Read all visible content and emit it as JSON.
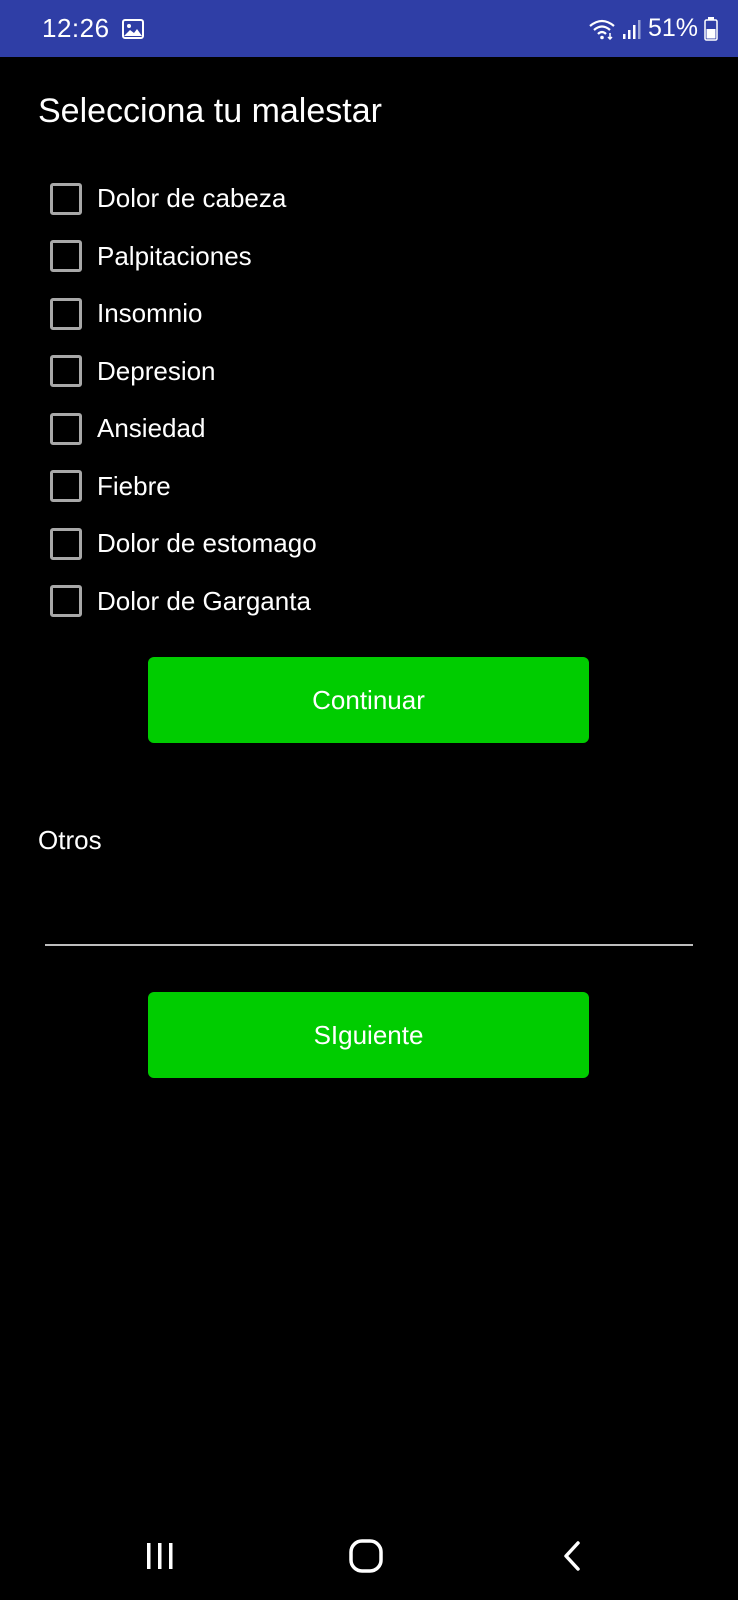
{
  "status_bar": {
    "time": "12:26",
    "battery_percent": "51%",
    "background_color": "#2f3ea6",
    "icons": [
      "gallery-icon",
      "wifi-icon",
      "signal-icon",
      "battery-icon"
    ]
  },
  "screen": {
    "title": "Selecciona tu malestar",
    "symptoms": [
      {
        "label": "Dolor de cabeza",
        "checked": false
      },
      {
        "label": "Palpitaciones",
        "checked": false
      },
      {
        "label": "Insomnio",
        "checked": false
      },
      {
        "label": "Depresion",
        "checked": false
      },
      {
        "label": "Ansiedad",
        "checked": false
      },
      {
        "label": "Fiebre",
        "checked": false
      },
      {
        "label": "Dolor de estomago",
        "checked": false
      },
      {
        "label": "Dolor de Garganta",
        "checked": false
      }
    ],
    "continue_button_label": "Continuar",
    "others_label": "Otros",
    "others_value": "",
    "next_button_label": "SIguiente",
    "accent_color": "#00cc00"
  },
  "nav_bar": {
    "icons": [
      "recents-icon",
      "home-icon",
      "back-icon"
    ]
  }
}
